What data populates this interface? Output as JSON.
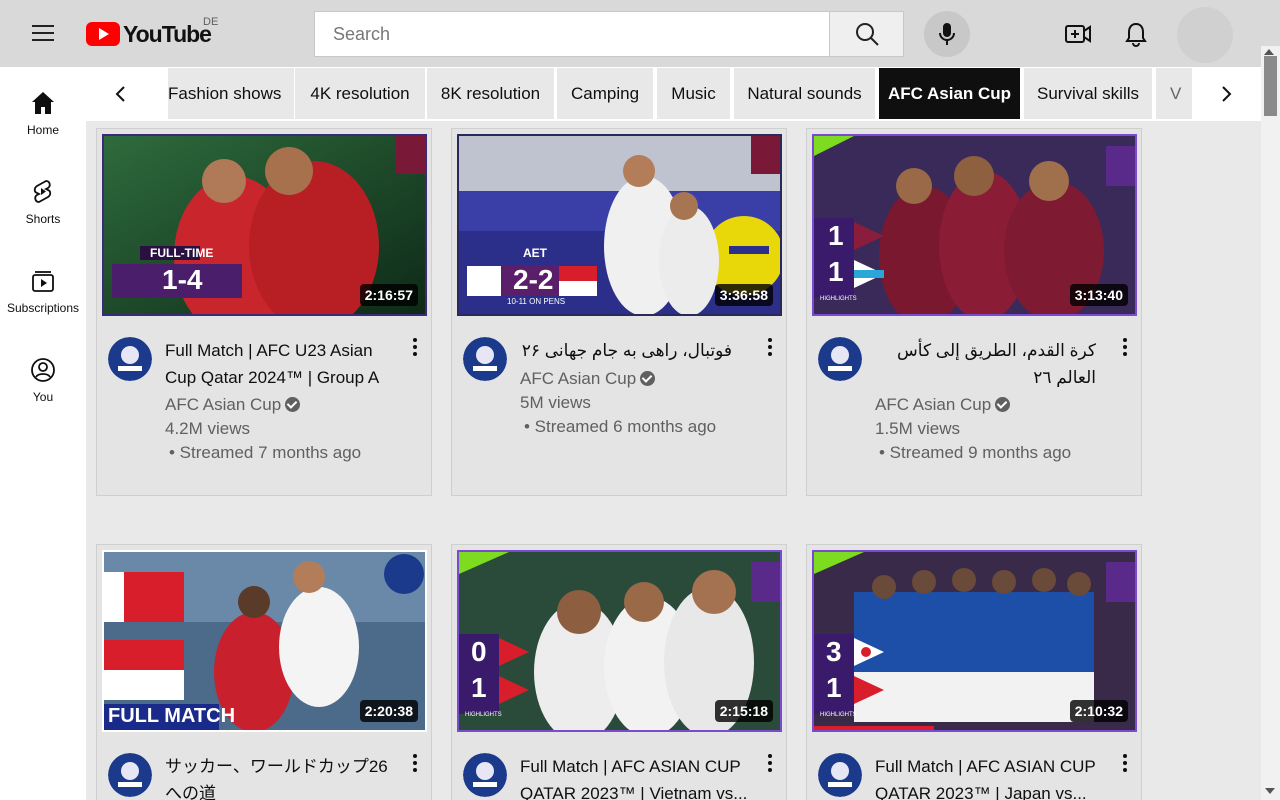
{
  "header": {
    "logo_text": "YouTube",
    "region": "DE",
    "search_placeholder": "Search"
  },
  "sidebar": {
    "items": [
      {
        "label": "Home",
        "icon": "home-icon"
      },
      {
        "label": "Shorts",
        "icon": "shorts-icon"
      },
      {
        "label": "Subscriptions",
        "icon": "subscriptions-icon"
      },
      {
        "label": "You",
        "icon": "you-icon"
      }
    ]
  },
  "chips": [
    {
      "label": "Fashion shows"
    },
    {
      "label": "4K resolution"
    },
    {
      "label": "8K resolution"
    },
    {
      "label": "Camping"
    },
    {
      "label": "Music"
    },
    {
      "label": "Natural sounds"
    },
    {
      "label": "AFC Asian Cup",
      "active": true
    },
    {
      "label": "Survival skills"
    },
    {
      "label": "V"
    }
  ],
  "videos": [
    {
      "title": "Full Match | AFC U23 Asian Cup Qatar 2024™ | Group A |...",
      "channel": "AFC Asian Cup",
      "views": "4.2M views",
      "time": "• Streamed 7 months ago",
      "duration": "2:16:57",
      "overlay_label": "FULL-TIME",
      "score": "1-4"
    },
    {
      "title": "فوتبال، راهی به جام جهانی ۲۶",
      "channel": "AFC Asian Cup",
      "views": "5M views",
      "time": "• Streamed 6 months ago",
      "duration": "3:36:58",
      "overlay_label": "AET",
      "score": "2-2",
      "sub_label": "10-11 ON PENS"
    },
    {
      "title": "كرة القدم، الطريق إلى كأس العالم ٢٦",
      "channel": "AFC Asian Cup",
      "views": "1.5M views",
      "time": "• Streamed 9 months ago",
      "duration": "3:13:40",
      "score_top": "1",
      "score_bottom": "1",
      "overlay_label": "HIGHLIGHTS"
    },
    {
      "title": "サッカー、ワールドカップ26への道",
      "duration": "2:20:38",
      "overlay_label": "FULL MATCH"
    },
    {
      "title": "Full Match | AFC ASIAN CUP QATAR 2023™ | Vietnam vs...",
      "duration": "2:15:18",
      "score_top": "0",
      "score_bottom": "1",
      "overlay_label": "HIGHLIGHTS"
    },
    {
      "title": "Full Match | AFC ASIAN CUP QATAR 2023™ | Japan vs...",
      "duration": "2:10:32",
      "score_top": "3",
      "score_bottom": "1",
      "overlay_label": "HIGHLIGHTS"
    }
  ],
  "colors": {
    "brand_red": "#ff0000",
    "chip_active_bg": "#0f0f0f",
    "thumb_border": "#6a4bbf"
  }
}
